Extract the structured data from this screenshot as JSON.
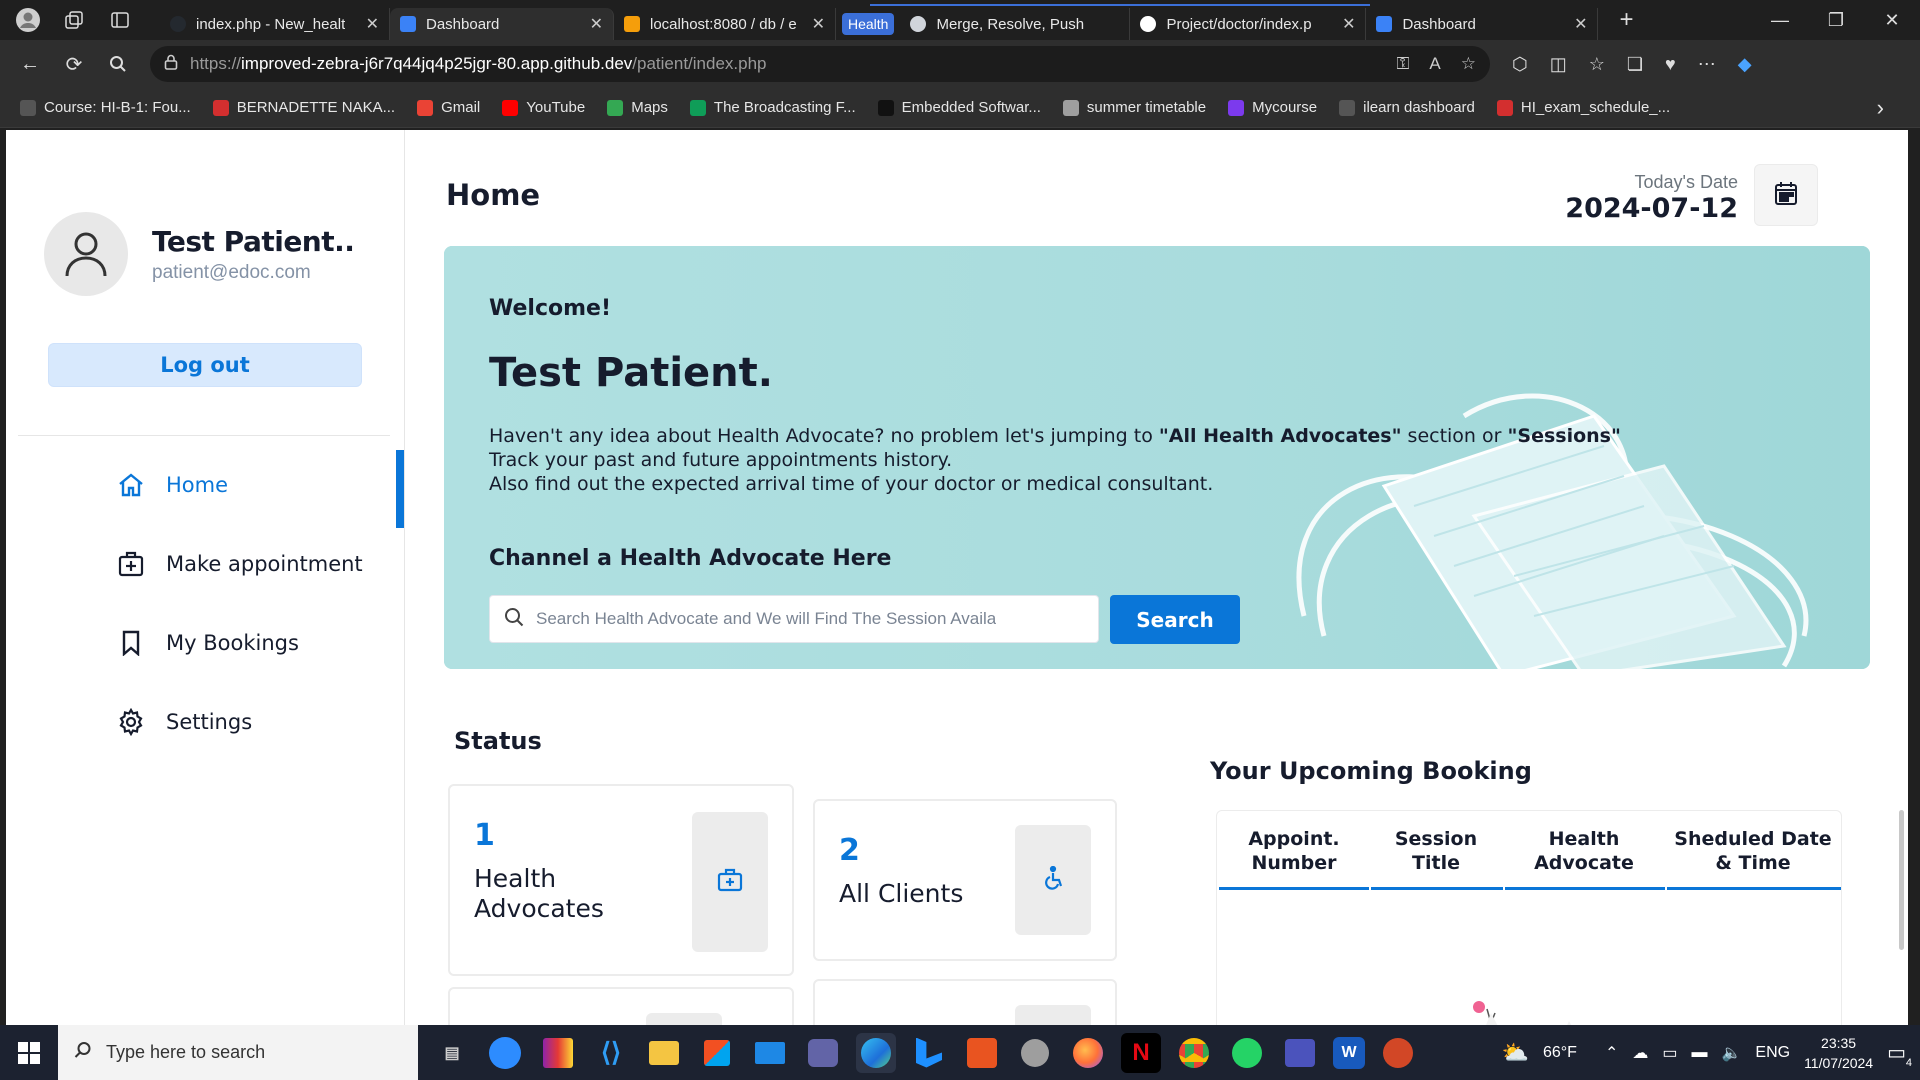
{
  "browser": {
    "tabs": [
      {
        "title": "index.php - New_healt",
        "favicon_color": "#24292f"
      },
      {
        "title": "Dashboard",
        "favicon_color": "#3b82f6",
        "active": true
      },
      {
        "title": "localhost:8080 / db / e",
        "favicon_color": "#f59e0b"
      },
      {
        "title": "Merge, Resolve, Push",
        "favicon_color": "#d1d5db"
      },
      {
        "title": "Project/doctor/index.p",
        "favicon_color": "#ffffff"
      },
      {
        "title": "Dashboard",
        "favicon_color": "#3b82f6"
      }
    ],
    "tab_group_label": "Health",
    "url_scheme": "https://",
    "url_host": "improved-zebra-j6r7q44jq4p25jgr-80.app.github.dev",
    "url_path": "/patient/index.php",
    "bookmarks": [
      {
        "label": "Course: HI-B-1: Fou...",
        "color": "#555"
      },
      {
        "label": "BERNADETTE NAKA...",
        "color": "#d32f2f"
      },
      {
        "label": "Gmail",
        "color": "#ea4335"
      },
      {
        "label": "YouTube",
        "color": "#ff0000"
      },
      {
        "label": "Maps",
        "color": "#34a853"
      },
      {
        "label": "The Broadcasting F...",
        "color": "#0f9d58"
      },
      {
        "label": "Embedded Softwar...",
        "color": "#111"
      },
      {
        "label": "summer timetable",
        "color": "#9e9e9e"
      },
      {
        "label": "Mycourse",
        "color": "#7c3aed"
      },
      {
        "label": "ilearn dashboard",
        "color": "#555"
      },
      {
        "label": "HI_exam_schedule_...",
        "color": "#d32f2f"
      }
    ]
  },
  "sidebar": {
    "profile_name": "Test Patient..",
    "profile_email": "patient@edoc.com",
    "logout_label": "Log out",
    "menu": [
      {
        "label": "Home",
        "icon": "home-icon",
        "active": true
      },
      {
        "label": "Make appointment",
        "icon": "calendar-plus-icon"
      },
      {
        "label": "My Bookings",
        "icon": "bookmark-icon"
      },
      {
        "label": "Settings",
        "icon": "gear-icon"
      }
    ]
  },
  "header": {
    "title": "Home",
    "date_label": "Today's Date",
    "date_value": "2024-07-12"
  },
  "banner": {
    "welcome": "Welcome!",
    "name": "Test Patient.",
    "line1_pre": "Haven't any idea about Health Advocate? no problem let's jumping to ",
    "line1_b1": "\"All Health Advocates\"",
    "line1_mid": " section or ",
    "line1_b2": "\"Sessions\"",
    "line2": "Track your past and future appointments history.",
    "line3": "Also find out the expected arrival time of your doctor or medical consultant.",
    "channel_title": "Channel a Health Advocate Here",
    "search_placeholder": "Search Health Advocate and We will Find The Session Availa",
    "search_button": "Search"
  },
  "status": {
    "title": "Status",
    "cards": [
      {
        "number": "1",
        "label_line1": "Health",
        "label_line2": "Advocates"
      },
      {
        "number": "2",
        "label_line1": "All Clients",
        "label_line2": ""
      }
    ]
  },
  "upcoming": {
    "title": "Your Upcoming Booking",
    "columns": [
      {
        "line1": "Appoint.",
        "line2": "Number"
      },
      {
        "line1": "Session",
        "line2": "Title"
      },
      {
        "line1": "Health",
        "line2": "Advocate"
      },
      {
        "line1": "Sheduled Date",
        "line2": "& Time"
      }
    ]
  },
  "taskbar": {
    "search_placeholder": "Type here to search",
    "weather": "66°F",
    "language": "ENG",
    "time": "23:35",
    "date": "11/07/2024",
    "notification_count": "4"
  }
}
